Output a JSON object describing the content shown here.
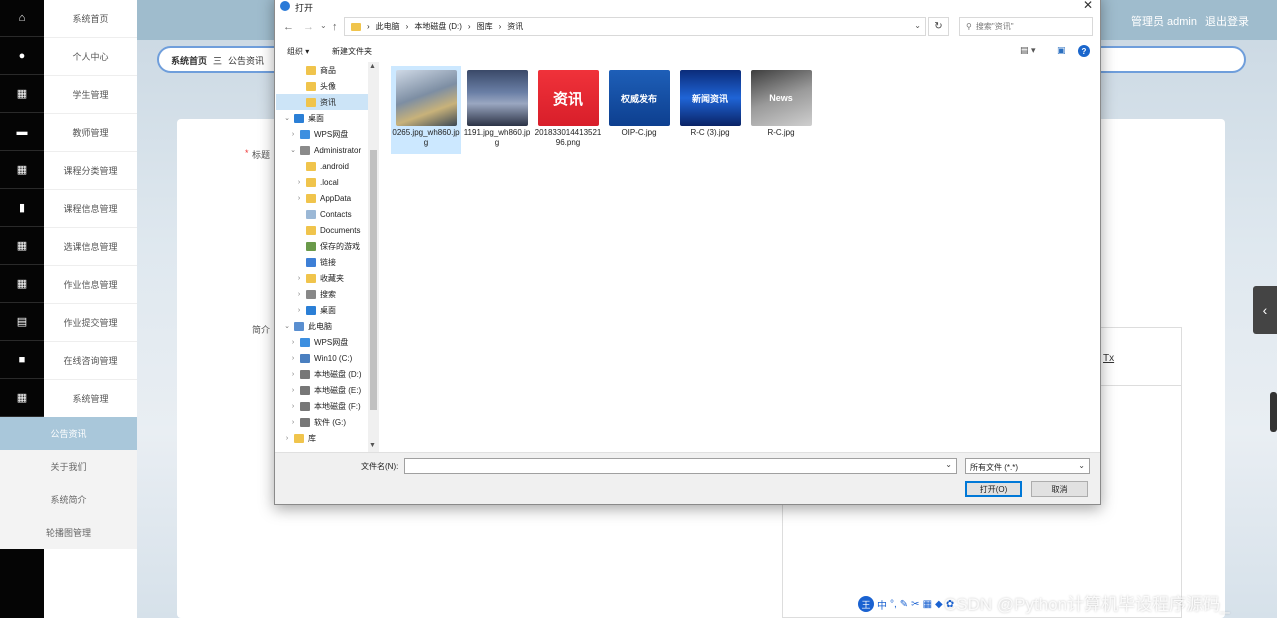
{
  "sidebar": {
    "items": [
      {
        "label": "系统首页",
        "icon": "home-icon",
        "glyph": "⌂"
      },
      {
        "label": "个人中心",
        "icon": "user-icon",
        "glyph": "●"
      },
      {
        "label": "学生管理",
        "icon": "grid-icon",
        "glyph": "▦"
      },
      {
        "label": "教师管理",
        "icon": "ticket-icon",
        "glyph": "▬"
      },
      {
        "label": "课程分类管理",
        "icon": "grid-icon",
        "glyph": "▦"
      },
      {
        "label": "课程信息管理",
        "icon": "book-icon",
        "glyph": "▮"
      },
      {
        "label": "选课信息管理",
        "icon": "grid-icon",
        "glyph": "▦"
      },
      {
        "label": "作业信息管理",
        "icon": "grid-icon",
        "glyph": "▦"
      },
      {
        "label": "作业提交管理",
        "icon": "table-icon",
        "glyph": "▤"
      },
      {
        "label": "在线咨询管理",
        "icon": "monitor-icon",
        "glyph": "■"
      },
      {
        "label": "系统管理",
        "icon": "grid-icon",
        "glyph": "▦"
      }
    ],
    "subitems": [
      {
        "label": "公告资讯",
        "active": true
      },
      {
        "label": "关于我们",
        "active": false
      },
      {
        "label": "系统简介",
        "active": false
      },
      {
        "label": "轮播图管理",
        "active": false
      }
    ]
  },
  "header": {
    "admin": "管理员 admin",
    "logout": "退出登录"
  },
  "breadcrumb": {
    "home": "系统首页",
    "sep": "三",
    "current": "公告资讯"
  },
  "form": {
    "required": "*",
    "title_label": "标题",
    "intro_label": "简介",
    "clear_format": "Tx"
  },
  "dialog": {
    "title": "打开",
    "close": "✕",
    "path": [
      "此电脑",
      "本地磁盘 (D:)",
      "图库",
      "资讯"
    ],
    "search_placeholder": "搜索\"资讯\"",
    "organize": "组织 ▾",
    "new_folder": "新建文件夹",
    "help": "?",
    "tree": [
      {
        "label": "商品",
        "indent": 2,
        "color": "#f0c44c",
        "expand": ""
      },
      {
        "label": "头像",
        "indent": 2,
        "color": "#f0c44c",
        "expand": ""
      },
      {
        "label": "资讯",
        "indent": 2,
        "color": "#f0c44c",
        "expand": "",
        "selected": true
      },
      {
        "label": "桌面",
        "indent": 0,
        "color": "#2b7fd6",
        "expand": "⌄"
      },
      {
        "label": "WPS网盘",
        "indent": 1,
        "color": "#3d8fe0",
        "expand": "›"
      },
      {
        "label": "Administrator",
        "indent": 1,
        "color": "#8a8a8a",
        "expand": "⌄"
      },
      {
        "label": ".android",
        "indent": 2,
        "color": "#f0c44c",
        "expand": ""
      },
      {
        "label": ".local",
        "indent": 2,
        "color": "#f0c44c",
        "expand": "›"
      },
      {
        "label": "AppData",
        "indent": 2,
        "color": "#f0c44c",
        "expand": "›"
      },
      {
        "label": "Contacts",
        "indent": 2,
        "color": "#9bb8d6",
        "expand": ""
      },
      {
        "label": "Documents",
        "indent": 2,
        "color": "#f0c44c",
        "expand": ""
      },
      {
        "label": "保存的游戏",
        "indent": 2,
        "color": "#6a9a4a",
        "expand": ""
      },
      {
        "label": "链接",
        "indent": 2,
        "color": "#3d7fd6",
        "expand": ""
      },
      {
        "label": "收藏夹",
        "indent": 2,
        "color": "#f0c44c",
        "expand": "›"
      },
      {
        "label": "搜索",
        "indent": 2,
        "color": "#888888",
        "expand": "›"
      },
      {
        "label": "桌面",
        "indent": 2,
        "color": "#2b7fd6",
        "expand": "›"
      },
      {
        "label": "此电脑",
        "indent": 0,
        "color": "#5a8fd0",
        "expand": "⌄"
      },
      {
        "label": "WPS网盘",
        "indent": 1,
        "color": "#3d8fe0",
        "expand": "›"
      },
      {
        "label": "Win10 (C:)",
        "indent": 1,
        "color": "#4a7fc0",
        "expand": "›"
      },
      {
        "label": "本地磁盘 (D:)",
        "indent": 1,
        "color": "#777777",
        "expand": "›"
      },
      {
        "label": "本地磁盘 (E:)",
        "indent": 1,
        "color": "#777777",
        "expand": "›"
      },
      {
        "label": "本地磁盘 (F:)",
        "indent": 1,
        "color": "#777777",
        "expand": "›"
      },
      {
        "label": "软件 (G:)",
        "indent": 1,
        "color": "#777777",
        "expand": "›"
      },
      {
        "label": "库",
        "indent": 0,
        "color": "#f0c44c",
        "expand": "›"
      }
    ],
    "files": [
      {
        "name": "0265.jpg_wh860.jpg",
        "selected": true,
        "bg": "linear-gradient(160deg,#cfd9e6 0%,#7d8ea3 45%,#c8b27a 70%,#3b4754 100%)",
        "text": ""
      },
      {
        "name": "1191.jpg_wh860.jpg",
        "selected": false,
        "bg": "linear-gradient(180deg,#3a4968 0%,#6a7fa6 40%,#9aa7c1 60%,#2c3346 100%)",
        "text": ""
      },
      {
        "name": "20183301441352196.png",
        "selected": false,
        "bg": "linear-gradient(180deg,#f0323a 0%,#d81e2a 100%)",
        "text": "资讯"
      },
      {
        "name": "OIP-C.jpg",
        "selected": false,
        "bg": "linear-gradient(180deg,#1e5fb8 0%,#0d3f8f 100%)",
        "text": "权威发布"
      },
      {
        "name": "R-C (3).jpg",
        "selected": false,
        "bg": "linear-gradient(180deg,#0b2c7a 0%,#1f64d6 50%,#0a2366 100%)",
        "text": "新闻资讯"
      },
      {
        "name": "R-C.jpg",
        "selected": false,
        "bg": "linear-gradient(160deg,#3e3e3e 0%,#9a9a9a 50%,#cfcfcf 100%)",
        "text": "News"
      }
    ],
    "filename_label": "文件名(N):",
    "filename_value": "",
    "filetype": "所有文件 (*.*)",
    "open": "打开(O)",
    "cancel": "取消"
  },
  "watermark": "CSDN @Python计算机毕设程序源码_",
  "ime": {
    "logo": "王",
    "mode": "中"
  },
  "colors": {
    "rail": "#050505",
    "active_menu": "#a9c7da",
    "topbar": "#9fbccd",
    "crumb_border": "#6f9edb"
  }
}
